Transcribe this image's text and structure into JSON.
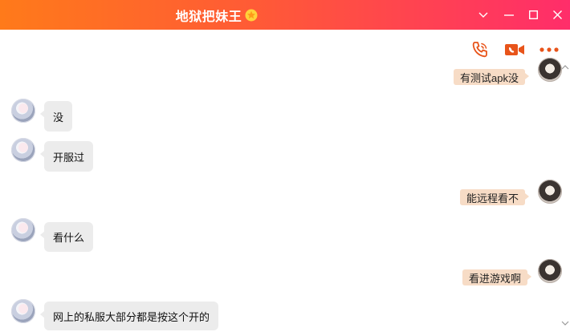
{
  "window": {
    "title": "地狱把妹王",
    "badge_icon": "star-badge-icon",
    "controls": [
      "chevron-down-icon",
      "minimize-icon",
      "maximize-icon",
      "close-icon"
    ]
  },
  "toolbar": {
    "icons": [
      "phone-icon",
      "video-call-icon",
      "more-icon"
    ],
    "accent_color": "#e8541a"
  },
  "messages": [
    {
      "side": "right",
      "text": "有测试apk没"
    },
    {
      "side": "left",
      "text": "没"
    },
    {
      "side": "left",
      "text": "开服过"
    },
    {
      "side": "right",
      "text": "能远程看不"
    },
    {
      "side": "left",
      "text": "看什么"
    },
    {
      "side": "right",
      "text": "看进游戏啊"
    },
    {
      "side": "left",
      "text": "网上的私服大部分都是按这个开的"
    }
  ],
  "colors": {
    "titlebar_start": "#ff7a1a",
    "titlebar_end": "#ff2d6a",
    "bubble_left": "#ececec",
    "bubble_right": "#f7dcc6"
  }
}
